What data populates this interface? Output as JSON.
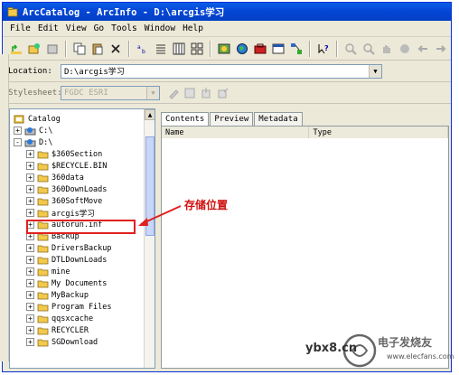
{
  "window": {
    "title": "ArcCatalog - ArcInfo - D:\\arcgis学习"
  },
  "menu": [
    "File",
    "Edit",
    "View",
    "Go",
    "Tools",
    "Window",
    "Help"
  ],
  "location": {
    "label": "Location:",
    "value": "D:\\arcgis学习"
  },
  "stylesheet": {
    "label": "Stylesheet:",
    "value": "FGDC ESRI"
  },
  "tree": {
    "root": "Catalog",
    "nodes": [
      {
        "label": "C:\\",
        "expander": "+"
      },
      {
        "label": "D:\\",
        "expander": "-"
      },
      {
        "label": "$360Section",
        "expander": "+"
      },
      {
        "label": "$RECYCLE.BIN",
        "expander": "+"
      },
      {
        "label": "360data",
        "expander": "+"
      },
      {
        "label": "360DownLoads",
        "expander": "+"
      },
      {
        "label": "360SoftMove",
        "expander": "+"
      },
      {
        "label": "arcgis学习",
        "expander": "+"
      },
      {
        "label": "autorun.inf",
        "expander": "+"
      },
      {
        "label": "Backup",
        "expander": "+"
      },
      {
        "label": "DriversBackup",
        "expander": "+"
      },
      {
        "label": "DTLDownLoads",
        "expander": "+"
      },
      {
        "label": "mine",
        "expander": "+"
      },
      {
        "label": "My Documents",
        "expander": "+"
      },
      {
        "label": "MyBackup",
        "expander": "+"
      },
      {
        "label": "Program Files",
        "expander": "+"
      },
      {
        "label": "qqsxcache",
        "expander": "+"
      },
      {
        "label": "RECYCLER",
        "expander": "+"
      },
      {
        "label": "SGDownload",
        "expander": "+"
      }
    ]
  },
  "tabs": [
    "Contents",
    "Preview",
    "Metadata"
  ],
  "columns": [
    "Name",
    "Type"
  ],
  "annotation": "存储位置",
  "watermark": {
    "site": "ybx8.cn",
    "brand": "电子发烧友",
    "url": "www.elecfans.com"
  },
  "colors": {
    "title_bar": "#0546d6",
    "annotation": "#d01010",
    "folder": "#f2c94c"
  }
}
